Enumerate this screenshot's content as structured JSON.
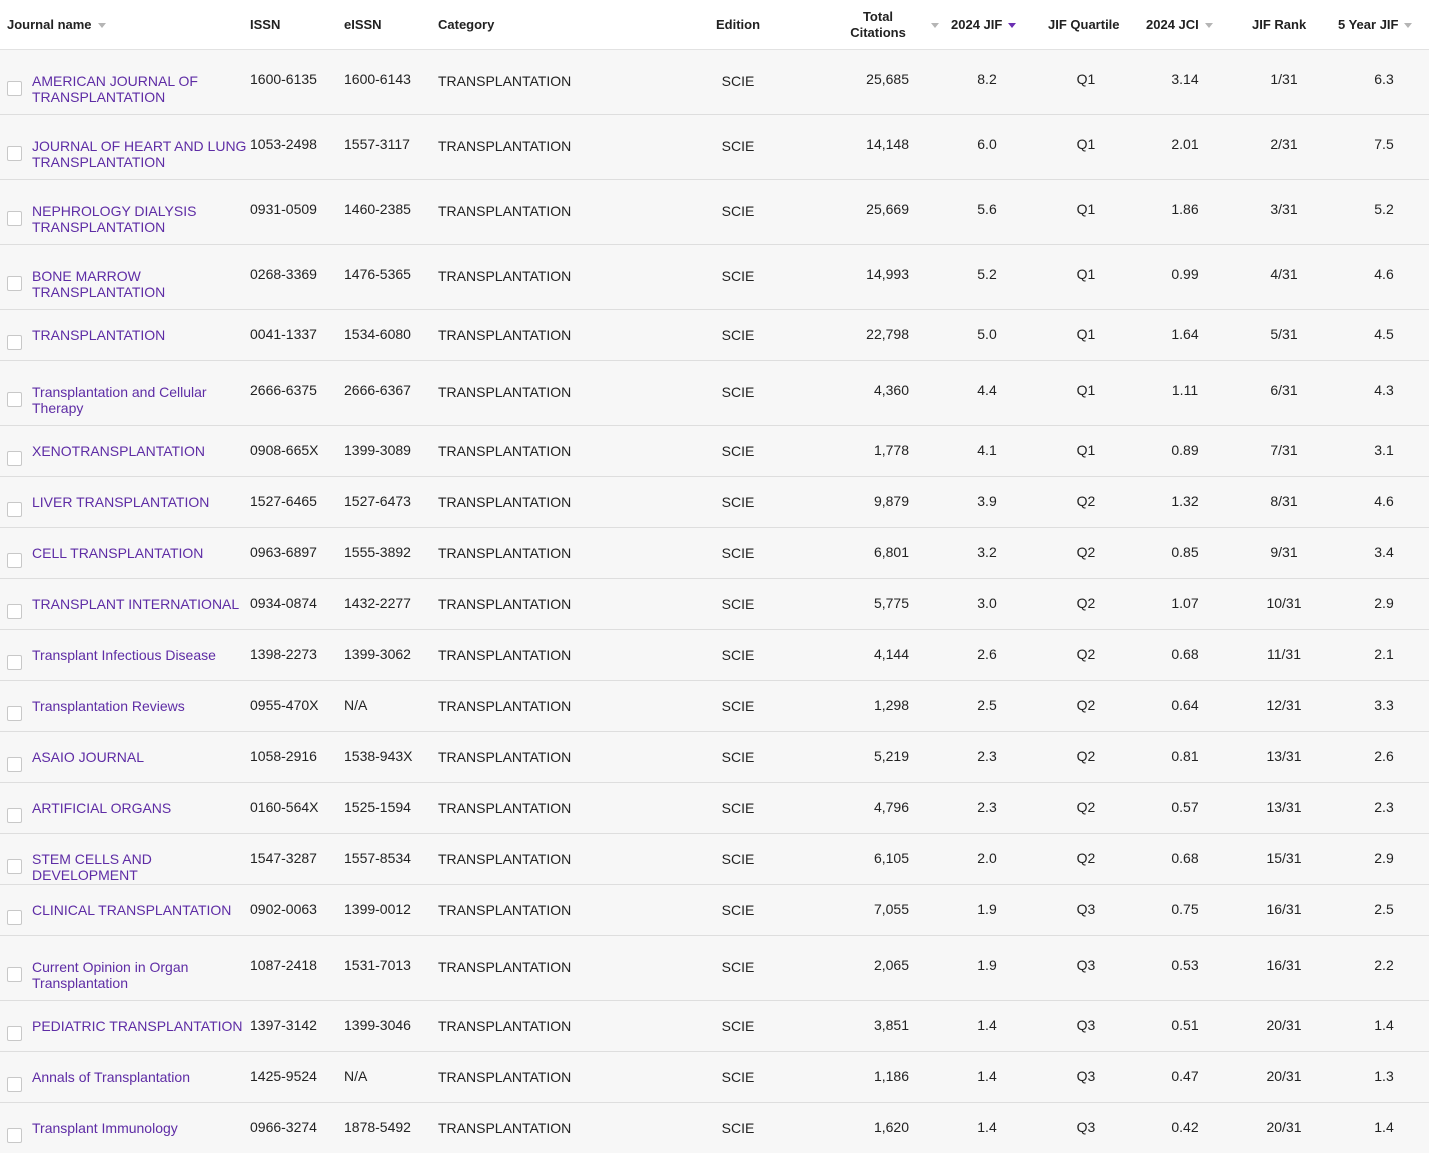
{
  "header": {
    "journal_name": "Journal name",
    "issn": "ISSN",
    "eissn": "eISSN",
    "category": "Category",
    "edition": "Edition",
    "total_citations_1": "Total",
    "total_citations_2": "Citations",
    "jif": "2024 JIF",
    "jif_quartile": "JIF Quartile",
    "jci": "2024 JCI",
    "jif_rank": "JIF Rank",
    "five_year_jif": "5 Year JIF"
  },
  "colors": {
    "link": "#5e2ca5",
    "active_sort": "#6b2fb3",
    "row_bg": "#f7f7f7"
  },
  "rows": [
    {
      "name": "AMERICAN JOURNAL OF TRANSPLANTATION",
      "issn": "1600-6135",
      "eissn": "1600-6143",
      "category": "TRANSPLANTATION",
      "edition": "SCIE",
      "citations": "25,685",
      "jif": "8.2",
      "quartile": "Q1",
      "jci": "3.14",
      "rank": "1/31",
      "five_year": "6.3"
    },
    {
      "name": "JOURNAL OF HEART AND LUNG TRANSPLANTATION",
      "issn": "1053-2498",
      "eissn": "1557-3117",
      "category": "TRANSPLANTATION",
      "edition": "SCIE",
      "citations": "14,148",
      "jif": "6.0",
      "quartile": "Q1",
      "jci": "2.01",
      "rank": "2/31",
      "five_year": "7.5"
    },
    {
      "name": "NEPHROLOGY DIALYSIS TRANSPLANTATION",
      "issn": "0931-0509",
      "eissn": "1460-2385",
      "category": "TRANSPLANTATION",
      "edition": "SCIE",
      "citations": "25,669",
      "jif": "5.6",
      "quartile": "Q1",
      "jci": "1.86",
      "rank": "3/31",
      "five_year": "5.2"
    },
    {
      "name": "BONE MARROW TRANSPLANTATION",
      "issn": "0268-3369",
      "eissn": "1476-5365",
      "category": "TRANSPLANTATION",
      "edition": "SCIE",
      "citations": "14,993",
      "jif": "5.2",
      "quartile": "Q1",
      "jci": "0.99",
      "rank": "4/31",
      "five_year": "4.6"
    },
    {
      "name": "TRANSPLANTATION",
      "issn": "0041-1337",
      "eissn": "1534-6080",
      "category": "TRANSPLANTATION",
      "edition": "SCIE",
      "citations": "22,798",
      "jif": "5.0",
      "quartile": "Q1",
      "jci": "1.64",
      "rank": "5/31",
      "five_year": "4.5"
    },
    {
      "name": "Transplantation and Cellular Therapy",
      "issn": "2666-6375",
      "eissn": "2666-6367",
      "category": "TRANSPLANTATION",
      "edition": "SCIE",
      "citations": "4,360",
      "jif": "4.4",
      "quartile": "Q1",
      "jci": "1.11",
      "rank": "6/31",
      "five_year": "4.3"
    },
    {
      "name": "XENOTRANSPLANTATION",
      "issn": "0908-665X",
      "eissn": "1399-3089",
      "category": "TRANSPLANTATION",
      "edition": "SCIE",
      "citations": "1,778",
      "jif": "4.1",
      "quartile": "Q1",
      "jci": "0.89",
      "rank": "7/31",
      "five_year": "3.1"
    },
    {
      "name": "LIVER TRANSPLANTATION",
      "issn": "1527-6465",
      "eissn": "1527-6473",
      "category": "TRANSPLANTATION",
      "edition": "SCIE",
      "citations": "9,879",
      "jif": "3.9",
      "quartile": "Q2",
      "jci": "1.32",
      "rank": "8/31",
      "five_year": "4.6"
    },
    {
      "name": "CELL TRANSPLANTATION",
      "issn": "0963-6897",
      "eissn": "1555-3892",
      "category": "TRANSPLANTATION",
      "edition": "SCIE",
      "citations": "6,801",
      "jif": "3.2",
      "quartile": "Q2",
      "jci": "0.85",
      "rank": "9/31",
      "five_year": "3.4"
    },
    {
      "name": "TRANSPLANT INTERNATIONAL",
      "issn": "0934-0874",
      "eissn": "1432-2277",
      "category": "TRANSPLANTATION",
      "edition": "SCIE",
      "citations": "5,775",
      "jif": "3.0",
      "quartile": "Q2",
      "jci": "1.07",
      "rank": "10/31",
      "five_year": "2.9"
    },
    {
      "name": "Transplant Infectious Disease",
      "issn": "1398-2273",
      "eissn": "1399-3062",
      "category": "TRANSPLANTATION",
      "edition": "SCIE",
      "citations": "4,144",
      "jif": "2.6",
      "quartile": "Q2",
      "jci": "0.68",
      "rank": "11/31",
      "five_year": "2.1"
    },
    {
      "name": "Transplantation Reviews",
      "issn": "0955-470X",
      "eissn": "N/A",
      "category": "TRANSPLANTATION",
      "edition": "SCIE",
      "citations": "1,298",
      "jif": "2.5",
      "quartile": "Q2",
      "jci": "0.64",
      "rank": "12/31",
      "five_year": "3.3"
    },
    {
      "name": "ASAIO JOURNAL",
      "issn": "1058-2916",
      "eissn": "1538-943X",
      "category": "TRANSPLANTATION",
      "edition": "SCIE",
      "citations": "5,219",
      "jif": "2.3",
      "quartile": "Q2",
      "jci": "0.81",
      "rank": "13/31",
      "five_year": "2.6"
    },
    {
      "name": "ARTIFICIAL ORGANS",
      "issn": "0160-564X",
      "eissn": "1525-1594",
      "category": "TRANSPLANTATION",
      "edition": "SCIE",
      "citations": "4,796",
      "jif": "2.3",
      "quartile": "Q2",
      "jci": "0.57",
      "rank": "13/31",
      "five_year": "2.3"
    },
    {
      "name": "STEM CELLS AND DEVELOPMENT",
      "issn": "1547-3287",
      "eissn": "1557-8534",
      "category": "TRANSPLANTATION",
      "edition": "SCIE",
      "citations": "6,105",
      "jif": "2.0",
      "quartile": "Q2",
      "jci": "0.68",
      "rank": "15/31",
      "five_year": "2.9"
    },
    {
      "name": "CLINICAL TRANSPLANTATION",
      "issn": "0902-0063",
      "eissn": "1399-0012",
      "category": "TRANSPLANTATION",
      "edition": "SCIE",
      "citations": "7,055",
      "jif": "1.9",
      "quartile": "Q3",
      "jci": "0.75",
      "rank": "16/31",
      "five_year": "2.5"
    },
    {
      "name": "Current Opinion in Organ Transplantation",
      "issn": "1087-2418",
      "eissn": "1531-7013",
      "category": "TRANSPLANTATION",
      "edition": "SCIE",
      "citations": "2,065",
      "jif": "1.9",
      "quartile": "Q3",
      "jci": "0.53",
      "rank": "16/31",
      "five_year": "2.2"
    },
    {
      "name": "PEDIATRIC TRANSPLANTATION",
      "issn": "1397-3142",
      "eissn": "1399-3046",
      "category": "TRANSPLANTATION",
      "edition": "SCIE",
      "citations": "3,851",
      "jif": "1.4",
      "quartile": "Q3",
      "jci": "0.51",
      "rank": "20/31",
      "five_year": "1.4"
    },
    {
      "name": "Annals of Transplantation",
      "issn": "1425-9524",
      "eissn": "N/A",
      "category": "TRANSPLANTATION",
      "edition": "SCIE",
      "citations": "1,186",
      "jif": "1.4",
      "quartile": "Q3",
      "jci": "0.47",
      "rank": "20/31",
      "five_year": "1.3"
    },
    {
      "name": "Transplant Immunology",
      "issn": "0966-3274",
      "eissn": "1878-5492",
      "category": "TRANSPLANTATION",
      "edition": "SCIE",
      "citations": "1,620",
      "jif": "1.4",
      "quartile": "Q3",
      "jci": "0.42",
      "rank": "20/31",
      "five_year": "1.4"
    }
  ]
}
